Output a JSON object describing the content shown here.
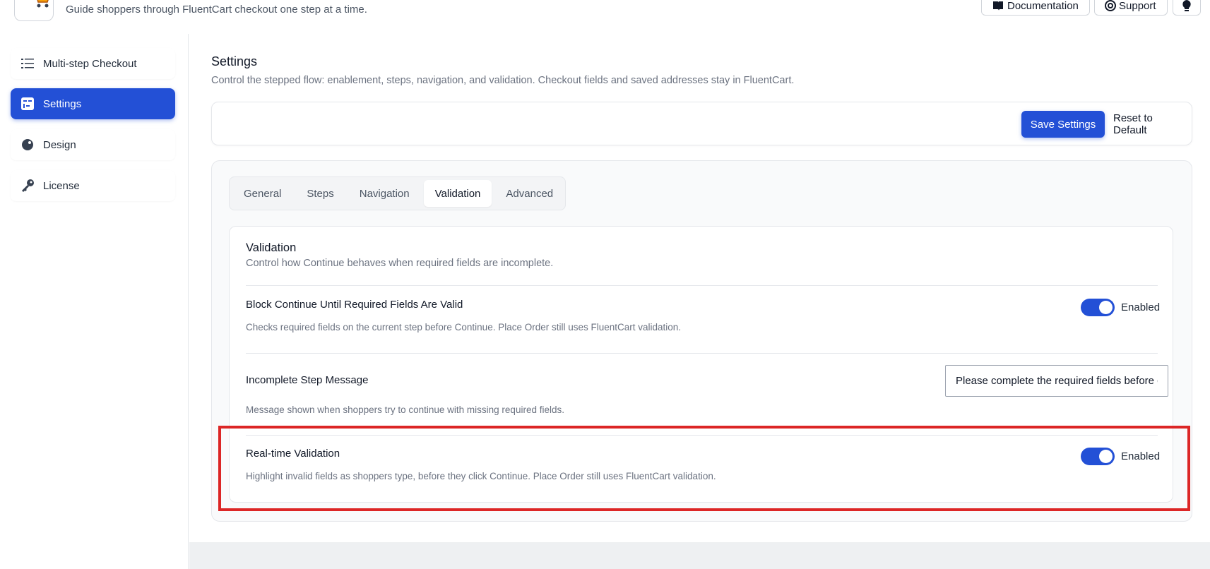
{
  "header": {
    "tagline": "Guide shoppers through FluentCart checkout one step at a time.",
    "documentation_label": "Documentation",
    "support_label": "Support"
  },
  "sidebar": {
    "items": [
      {
        "label": "Multi-step Checkout",
        "icon": "list-icon",
        "active": false
      },
      {
        "label": "Settings",
        "icon": "settings-panel-icon",
        "active": true
      },
      {
        "label": "Design",
        "icon": "palette-icon",
        "active": false
      },
      {
        "label": "License",
        "icon": "key-icon",
        "active": false
      }
    ]
  },
  "main": {
    "title": "Settings",
    "description": "Control the stepped flow: enablement, steps, navigation, and validation. Checkout fields and saved addresses stay in FluentCart.",
    "save_label": "Save Settings",
    "reset_label": "Reset to Default",
    "tabs": [
      "General",
      "Steps",
      "Navigation",
      "Validation",
      "Advanced"
    ],
    "active_tab": "Validation",
    "validation": {
      "title": "Validation",
      "description": "Control how Continue behaves when required fields are incomplete.",
      "block_continue": {
        "label": "Block Continue Until Required Fields Are Valid",
        "help": "Checks required fields on the current step before Continue. Place Order still uses FluentCart validation.",
        "state": "Enabled"
      },
      "incomplete_message": {
        "label": "Incomplete Step Message",
        "value": "Please complete the required fields before continuing.",
        "help": "Message shown when shoppers try to continue with missing required fields."
      },
      "realtime": {
        "label": "Real-time Validation",
        "help": "Highlight invalid fields as shoppers type, before they click Continue. Place Order still uses FluentCart validation.",
        "state": "Enabled"
      }
    }
  },
  "colors": {
    "accent": "#2350d6",
    "highlight": "#dc2626"
  }
}
